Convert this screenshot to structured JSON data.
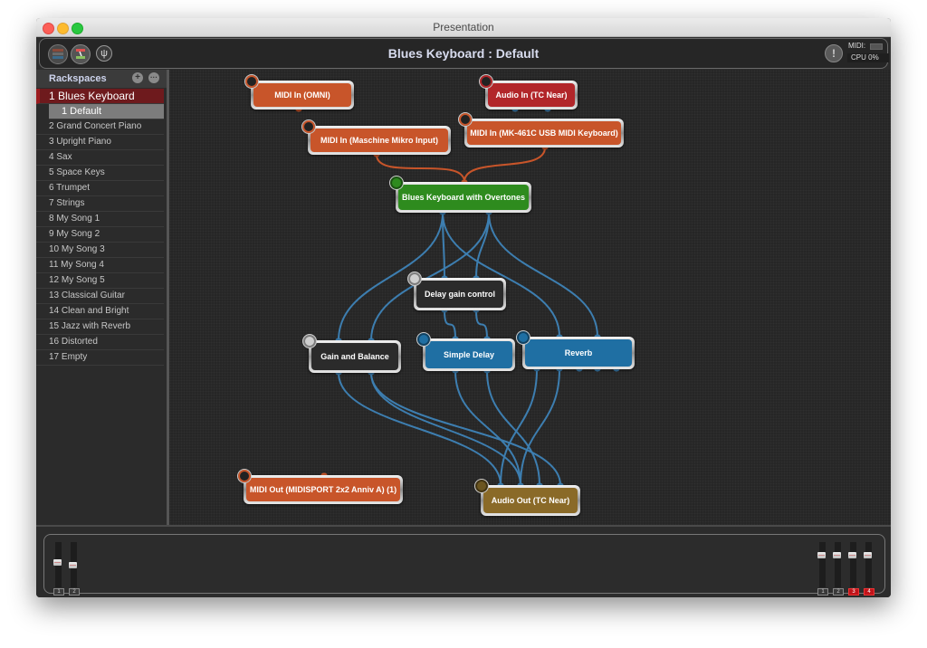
{
  "window": {
    "title": "Presentation"
  },
  "toolbar": {
    "icons": [
      "rackspace-view-icon",
      "wiring-view-icon",
      "tuner-icon"
    ],
    "tuner_glyph": "ψ",
    "title": "Blues Keyboard : Default",
    "warning_glyph": "!",
    "midi_label": "MIDI:",
    "cpu_label": "CPU  0%"
  },
  "sidebar": {
    "title": "Rackspaces",
    "add_glyph": "+",
    "more_glyph": "···",
    "selected": {
      "label": "1 Blues Keyboard"
    },
    "variation": {
      "label": "1  Default"
    },
    "items": [
      {
        "label": "2 Grand Concert Piano"
      },
      {
        "label": "3 Upright Piano"
      },
      {
        "label": "4 Sax"
      },
      {
        "label": "5 Space Keys"
      },
      {
        "label": "6 Trumpet"
      },
      {
        "label": "7 Strings"
      },
      {
        "label": "8 My Song 1"
      },
      {
        "label": "9 My Song 2"
      },
      {
        "label": "10 My Song 3"
      },
      {
        "label": "11 My Song 4"
      },
      {
        "label": "12 My Song 5"
      },
      {
        "label": "13 Classical Guitar"
      },
      {
        "label": "14 Clean and Bright"
      },
      {
        "label": "15 Jazz with Reverb"
      },
      {
        "label": "16 Distorted"
      },
      {
        "label": "17 Empty"
      }
    ]
  },
  "colors": {
    "midi": "#c8552a",
    "audio_in": "#b2262a",
    "instrument": "#2e8b1e",
    "effect": "#1f6fa3",
    "control": "#2b2b2b",
    "audio_out": "#8a6a28",
    "midi_wire": "#c8552a",
    "audio_wire": "#3d7eb0"
  },
  "nodes": {
    "midi_in_omni": {
      "label": "MIDI In (OMNI)",
      "type": "midi",
      "icon": "midi-port-icon"
    },
    "audio_in": {
      "label": "Audio In (TC Near)",
      "type": "audio_in",
      "icon": "microphone-icon"
    },
    "midi_in_maschine": {
      "label": "MIDI In (Maschine Mikro Input)",
      "type": "midi",
      "icon": "midi-port-icon"
    },
    "midi_in_mk461c": {
      "label": "MIDI In (MK-461C USB MIDI Keyboard)",
      "type": "midi",
      "icon": "midi-port-icon"
    },
    "blues_keyboard": {
      "label": "Blues Keyboard with Overtones",
      "type": "instrument",
      "icon": "waveform-icon"
    },
    "delay_gain": {
      "label": "Delay gain control",
      "type": "control",
      "icon": "mixer-icon"
    },
    "gain_balance": {
      "label": "Gain and Balance",
      "type": "control",
      "icon": "mixer-icon"
    },
    "simple_delay": {
      "label": "Simple Delay",
      "type": "effect",
      "icon": "knob-icon"
    },
    "reverb": {
      "label": "Reverb",
      "type": "effect",
      "icon": "knob-icon"
    },
    "midi_out": {
      "label": "MIDI Out (MIDISPORT 2x2 Anniv A) (1)",
      "type": "midi",
      "icon": "midi-port-icon"
    },
    "audio_out": {
      "label": "Audio Out (TC Near)",
      "type": "audio_out",
      "icon": "speaker-icon"
    }
  },
  "mixer": {
    "inputs": [
      {
        "label": "1",
        "level": 0.55
      },
      {
        "label": "2",
        "level": 0.5
      }
    ],
    "outputs": [
      {
        "label": "1",
        "level": 0.75,
        "active": false
      },
      {
        "label": "2",
        "level": 0.75,
        "active": false
      },
      {
        "label": "3",
        "level": 0.75,
        "active": true
      },
      {
        "label": "4",
        "level": 0.75,
        "active": true
      }
    ]
  }
}
